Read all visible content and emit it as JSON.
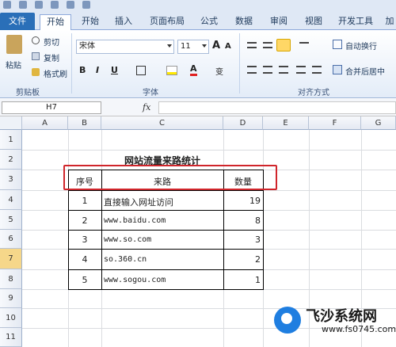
{
  "ribbon_tabs": [
    "文件",
    "开始",
    "开始",
    "插入",
    "页面布局",
    "公式",
    "数据",
    "审阅",
    "视图",
    "开发工具",
    "加"
  ],
  "clipboard": {
    "paste": "粘贴",
    "cut": "剪切",
    "copy": "复制",
    "format_painter": "格式刷",
    "group_label": "剪贴板"
  },
  "font": {
    "family": "宋体",
    "size": "11",
    "bold": "B",
    "italic": "I",
    "underline": "U",
    "grow": "A",
    "shrink": "A",
    "font_color_letter": "A",
    "wen": "变",
    "group_label": "字体"
  },
  "alignment": {
    "wrap": "自动换行",
    "merge": "合并后居中",
    "group_label": "对齐方式"
  },
  "formula_bar": {
    "name_box": "H7",
    "fx": "fx",
    "value": ""
  },
  "columns": [
    "A",
    "B",
    "C",
    "D",
    "E",
    "F",
    "G"
  ],
  "rows": [
    "1",
    "2",
    "3",
    "4",
    "5",
    "6",
    "7",
    "8",
    "9",
    "10",
    "11"
  ],
  "sheet": {
    "title": "网站流量来路统计",
    "headers": [
      "序号",
      "来路",
      "数量"
    ],
    "data": [
      {
        "no": "1",
        "source": "直接输入网址访问",
        "count": "19"
      },
      {
        "no": "2",
        "source": "www.baidu.com",
        "count": "8"
      },
      {
        "no": "3",
        "source": "www.so.com",
        "count": "3"
      },
      {
        "no": "4",
        "source": "so.360.cn",
        "count": "2"
      },
      {
        "no": "5",
        "source": "www.sogou.com",
        "count": "1"
      }
    ]
  },
  "watermark": {
    "title": "飞沙系统网",
    "url": "www.fs0745.com"
  },
  "colors": {
    "file_tab": "#2a6fb8",
    "highlight_border": "#d0252b",
    "ribbon_bg": "#dfe8f5"
  }
}
